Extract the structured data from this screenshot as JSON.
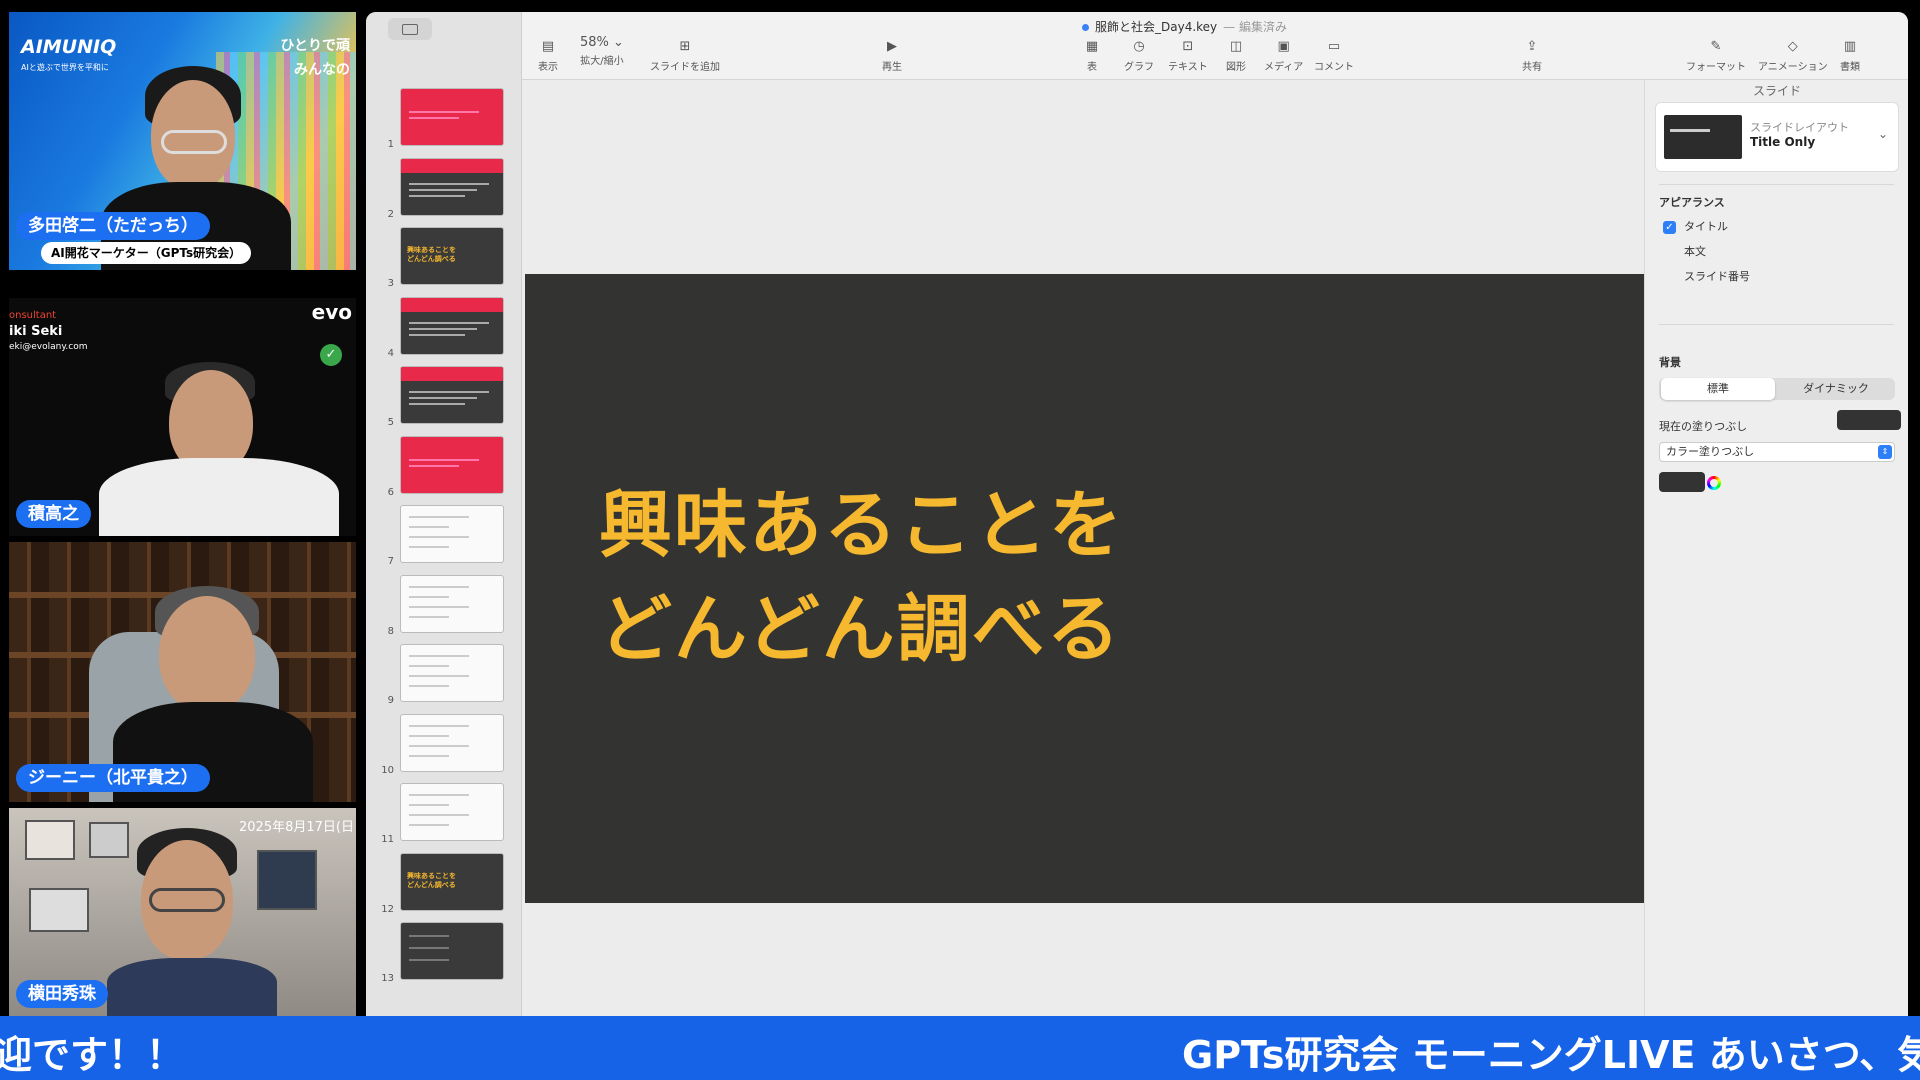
{
  "participants": [
    {
      "name": "多田啓二（ただっち）",
      "subtitle": "AI開花マーケター（GPTs研究会）",
      "brand": "AIMUNIQ",
      "brand_tagline": "AIと遊ぶで世界を平和に",
      "overlay_text": "ひとりで頑\nみんなの"
    },
    {
      "name": "積高之",
      "brand_lines": [
        "onsultant",
        "iki Seki",
        "eki@evolany.com"
      ],
      "logo": "evo"
    },
    {
      "name": "ジーニー（北平貴之）"
    },
    {
      "name": "横田秀珠",
      "timestamp": "2025年8月17日(日"
    }
  ],
  "keynote": {
    "document_title": "服飾と社会_Day4.key",
    "document_status": "編集済み",
    "toolbar": {
      "view": {
        "label": "表示",
        "icon": "sidebar-icon"
      },
      "zoom": {
        "label": "拡大/縮小",
        "value": "58%"
      },
      "add_slide": {
        "label": "スライドを追加",
        "icon": "add-slide-icon"
      },
      "play": {
        "label": "再生",
        "icon": "play-icon"
      },
      "table": {
        "label": "表",
        "icon": "table-icon"
      },
      "chart": {
        "label": "グラフ",
        "icon": "chart-icon"
      },
      "text": {
        "label": "テキスト",
        "icon": "text-icon"
      },
      "shape": {
        "label": "図形",
        "icon": "shape-icon"
      },
      "media": {
        "label": "メディア",
        "icon": "media-icon"
      },
      "comment": {
        "label": "コメント",
        "icon": "comment-icon"
      },
      "share": {
        "label": "共有",
        "icon": "share-icon"
      },
      "format": {
        "label": "フォーマット",
        "icon": "paintbrush-icon"
      },
      "animate": {
        "label": "アニメーション",
        "icon": "diamond-icon"
      },
      "document": {
        "label": "書類",
        "icon": "document-icon"
      }
    },
    "slides": [
      {
        "num": "1",
        "style": "red"
      },
      {
        "num": "2",
        "style": "dark-red"
      },
      {
        "num": "3",
        "style": "dark-text",
        "text": "興味あることを\nどんどん調べる"
      },
      {
        "num": "4",
        "style": "dark-red"
      },
      {
        "num": "5",
        "style": "dark-red"
      },
      {
        "num": "6",
        "style": "red"
      },
      {
        "num": "7",
        "style": "white"
      },
      {
        "num": "8",
        "style": "white"
      },
      {
        "num": "9",
        "style": "white"
      },
      {
        "num": "10",
        "style": "white"
      },
      {
        "num": "11",
        "style": "white"
      },
      {
        "num": "12",
        "style": "dark-text",
        "text": "興味あることを\nどんどん調べる"
      },
      {
        "num": "13",
        "style": "dark"
      }
    ],
    "current_slide": {
      "title_line1": "興味あることを",
      "title_line2": "どんどん調べる",
      "bg_color": "#333432",
      "title_color": "#f5b82e"
    },
    "inspector": {
      "tab": "スライド",
      "layout_label": "スライドレイアウト",
      "layout_value": "Title Only",
      "appearance_heading": "アピアランス",
      "options": [
        {
          "label": "タイトル",
          "checked": true
        },
        {
          "label": "本文",
          "checked": false
        },
        {
          "label": "スライド番号",
          "checked": false
        }
      ],
      "background_heading": "背景",
      "bg_modes": [
        "標準",
        "ダイナミック"
      ],
      "current_fill_label": "現在の塗りつぶし",
      "fill_type": "カラー塗りつぶし",
      "fill_color": "#333333"
    }
  },
  "ticker": {
    "left_text": "迎です！！",
    "right_text": "GPTs研究会 モーニングLIVE あいさつ、気"
  }
}
